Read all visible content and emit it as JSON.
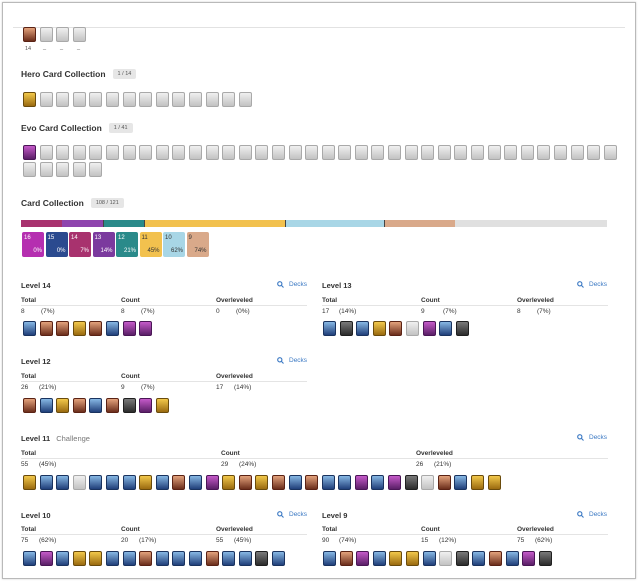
{
  "top": {
    "count_label": "14",
    "dashes": [
      "_",
      "_",
      "_"
    ]
  },
  "hero": {
    "title": "Hero Card Collection",
    "badge": "1 / 14"
  },
  "evo": {
    "title": "Evo Card Collection",
    "badge": "1 / 41"
  },
  "collection": {
    "title": "Card Collection",
    "badge": "108 / 121",
    "bar_segments": [
      {
        "color": "#a8326e",
        "share": 0.07
      },
      {
        "color": "#8e44ad",
        "share": 0.07
      },
      {
        "color": "#2a8a8a",
        "share": 0.07
      },
      {
        "color": "#f2c14e",
        "share": 0.24
      },
      {
        "color": "#a8d6e6",
        "share": 0.17
      },
      {
        "color": "#d9a98a",
        "share": 0.12
      },
      {
        "color": "#e0e0e0",
        "share": 0.26
      }
    ],
    "boxes": [
      {
        "level": "16",
        "pct": "0%",
        "color": "#b52fb0"
      },
      {
        "level": "15",
        "pct": "0%",
        "color": "#2b4a8f"
      },
      {
        "level": "14",
        "pct": "7%",
        "color": "#a8326e"
      },
      {
        "level": "13",
        "pct": "14%",
        "color": "#7b3a9e"
      },
      {
        "level": "12",
        "pct": "21%",
        "color": "#2a8a8a"
      },
      {
        "level": "11",
        "pct": "45%",
        "color": "#f2c14e"
      },
      {
        "level": "10",
        "pct": "62%",
        "color": "#a8d6e6"
      },
      {
        "level": "9",
        "pct": "74%",
        "color": "#d9a98a"
      }
    ]
  },
  "headers": {
    "total": "Total",
    "count": "Count",
    "overleveled": "Overleveled",
    "decks": "Decks"
  },
  "levels": {
    "l14": {
      "title": "Level 14",
      "total": "8",
      "total_pct": "(7%)",
      "count": "8",
      "count_pct": "(7%)",
      "over": "0",
      "over_pct": "(0%)"
    },
    "l13": {
      "title": "Level 13",
      "total": "17",
      "total_pct": "(14%)",
      "count": "9",
      "count_pct": "(7%)",
      "over": "8",
      "over_pct": "(7%)"
    },
    "l12": {
      "title": "Level 12",
      "total": "26",
      "total_pct": "(21%)",
      "count": "9",
      "count_pct": "(7%)",
      "over": "17",
      "over_pct": "(14%)"
    },
    "l11": {
      "title": "Level 11",
      "subtitle": "Challenge",
      "total": "55",
      "total_pct": "(45%)",
      "count": "29",
      "count_pct": "(24%)",
      "over": "26",
      "over_pct": "(21%)"
    },
    "l10": {
      "title": "Level 10",
      "total": "75",
      "total_pct": "(62%)",
      "count": "20",
      "count_pct": "(17%)",
      "over": "55",
      "over_pct": "(45%)"
    },
    "l9": {
      "title": "Level 9",
      "total": "90",
      "total_pct": "(74%)",
      "count": "15",
      "count_pct": "(12%)",
      "over": "75",
      "over_pct": "(62%)"
    }
  }
}
